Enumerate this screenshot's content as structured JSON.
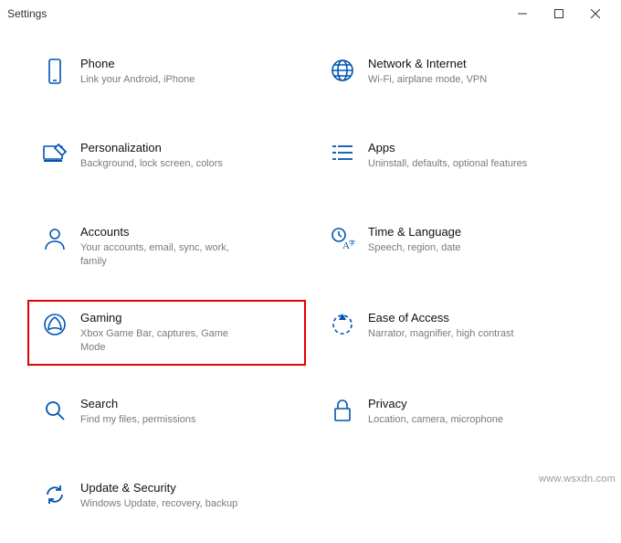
{
  "window": {
    "title": "Settings"
  },
  "categories": [
    {
      "id": "phone",
      "title": "Phone",
      "sub": "Link your Android, iPhone"
    },
    {
      "id": "network",
      "title": "Network & Internet",
      "sub": "Wi-Fi, airplane mode, VPN"
    },
    {
      "id": "personalization",
      "title": "Personalization",
      "sub": "Background, lock screen, colors"
    },
    {
      "id": "apps",
      "title": "Apps",
      "sub": "Uninstall, defaults, optional features"
    },
    {
      "id": "accounts",
      "title": "Accounts",
      "sub": "Your accounts, email, sync, work, family"
    },
    {
      "id": "time",
      "title": "Time & Language",
      "sub": "Speech, region, date"
    },
    {
      "id": "gaming",
      "title": "Gaming",
      "sub": "Xbox Game Bar, captures, Game Mode",
      "highlight": true
    },
    {
      "id": "ease",
      "title": "Ease of Access",
      "sub": "Narrator, magnifier, high contrast"
    },
    {
      "id": "search",
      "title": "Search",
      "sub": "Find my files, permissions"
    },
    {
      "id": "privacy",
      "title": "Privacy",
      "sub": "Location, camera, microphone"
    },
    {
      "id": "update",
      "title": "Update & Security",
      "sub": "Windows Update, recovery, backup"
    }
  ],
  "watermark": "www.wsxdn.com"
}
